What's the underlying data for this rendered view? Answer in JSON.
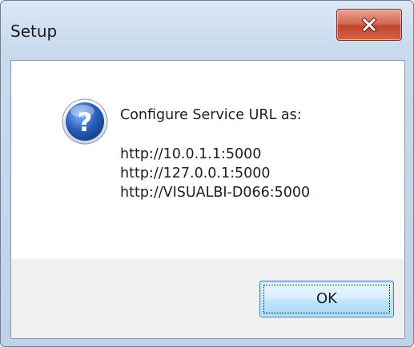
{
  "window": {
    "title": "Setup"
  },
  "icon": "question-icon",
  "message": {
    "heading": "Configure Service URL as:",
    "urls": [
      "http://10.0.1.1:5000",
      "http://127.0.0.1:5000",
      "http://VISUALBI-D066:5000"
    ]
  },
  "buttons": {
    "ok_label": "OK"
  },
  "colors": {
    "close_button": "#c94b32",
    "question_icon": "#2a5fb8",
    "ok_button_border": "#3c7fb1"
  }
}
